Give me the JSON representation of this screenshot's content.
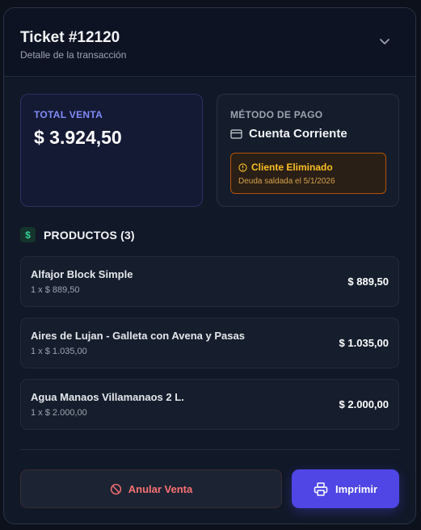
{
  "header": {
    "title": "Ticket #12120",
    "subtitle": "Detalle de la transacción"
  },
  "total": {
    "label": "TOTAL VENTA",
    "value": "$ 3.924,50"
  },
  "payment": {
    "label": "MÉTODO DE PAGO",
    "method": "Cuenta Corriente",
    "warning_title": "Cliente Eliminado",
    "warning_detail": "Deuda saldada el 5/1/2026"
  },
  "products": {
    "title": "PRODUCTOS (3)",
    "items": [
      {
        "name": "Alfajor Block Simple",
        "qty": "1 x $ 889,50",
        "price": "$ 889,50"
      },
      {
        "name": "Aires de Lujan - Galleta con Avena y Pasas",
        "qty": "1 x $ 1.035,00",
        "price": "$ 1.035,00"
      },
      {
        "name": "Agua Manaos Villamanaos 2 L.",
        "qty": "1 x $ 2.000,00",
        "price": "$ 2.000,00"
      }
    ]
  },
  "actions": {
    "cancel_label": "Anular Venta",
    "print_label": "Imprimir"
  },
  "icons": {
    "collapse": "chevron-down-icon",
    "payment": "credit-card-icon",
    "warning": "alert-circle-icon",
    "products": "dollar-icon",
    "cancel": "ban-icon",
    "print": "printer-icon"
  },
  "colors": {
    "accent": "#4f46e5",
    "total_label": "#818cf8",
    "warning": "#fbbf24",
    "danger": "#f87171",
    "money": "#34d399"
  }
}
